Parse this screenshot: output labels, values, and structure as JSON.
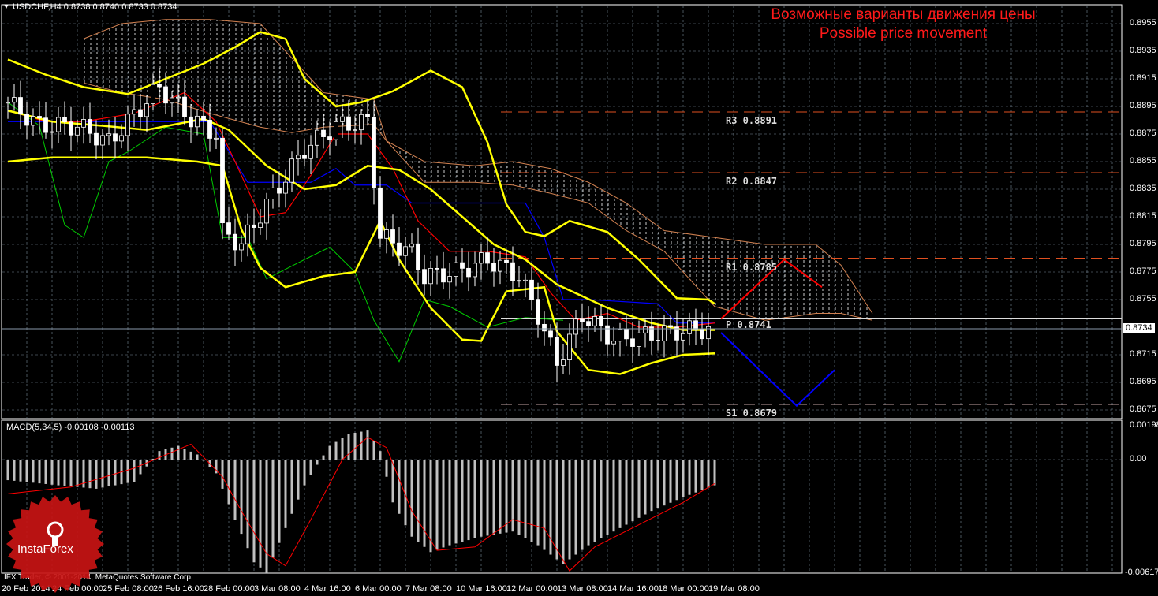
{
  "header": {
    "symbol_line": "USDCHF,H4  0.8738 0.8740 0.8733 0.8734"
  },
  "title": {
    "ru": "Возможные варианты движения цены",
    "en": "Possible price movement"
  },
  "macd_label": "MACD(5,34,5) -0.00108 -0.00113",
  "copyright": "IFX Trader, © 2001-2014, MetaQuotes Software Corp.",
  "logo": "InstaForex",
  "current_price": "0.8734",
  "price_axis": [
    "0.8955",
    "0.8935",
    "0.8915",
    "0.8895",
    "0.8875",
    "0.8855",
    "0.8835",
    "0.8815",
    "0.8795",
    "0.8775",
    "0.8755",
    "0.8715",
    "0.8695",
    "0.8675"
  ],
  "macd_axis": [
    "0.00198",
    "0.00",
    "-0.00617"
  ],
  "time_axis": [
    "20 Feb 2014",
    "24 Feb 00:00",
    "25 Feb 08:00",
    "26 Feb 16:00",
    "28 Feb 00:00",
    "3 Mar 08:00",
    "4 Mar 16:00",
    "6 Mar 00:00",
    "7 Mar 08:00",
    "10 Mar 16:00",
    "12 Mar 00:00",
    "13 Mar 08:00",
    "14 Mar 16:00",
    "18 Mar 00:00",
    "19 Mar 08:00"
  ],
  "pivots": [
    {
      "name": "R3",
      "value": 0.8891,
      "label": "R3  0.8891"
    },
    {
      "name": "R2",
      "value": 0.8847,
      "label": "R2  0.8847"
    },
    {
      "name": "R1",
      "value": 0.8785,
      "label": "R1  0.8785"
    },
    {
      "name": "P",
      "value": 0.8741,
      "label": "P  0.8741"
    },
    {
      "name": "S1",
      "value": 0.8679,
      "label": "S1  0.8679"
    }
  ],
  "colors": {
    "bg": "#000000",
    "grid": "#7a8a99",
    "bollinger": "#ffff00",
    "tenkan": "#ff0000",
    "kijun": "#0000ff",
    "chikou": "#00cc00",
    "up_scenario": "#ff0000",
    "down_scenario": "#0000ff",
    "cloud": "#ffffff",
    "macd_hist": "#c0c0c0",
    "macd_signal": "#ff0000"
  },
  "chart_data": {
    "type": "candlestick",
    "price_range": [
      0.8662,
      0.8968
    ],
    "close_keys": [
      [
        0,
        0.8898
      ],
      [
        5,
        0.8881
      ],
      [
        11,
        0.8881
      ],
      [
        16,
        0.8869
      ],
      [
        24,
        0.8909
      ],
      [
        29,
        0.8886
      ],
      [
        33,
        0.8875
      ],
      [
        34,
        0.8804
      ],
      [
        37,
        0.8795
      ],
      [
        41,
        0.8824
      ],
      [
        47,
        0.8864
      ],
      [
        52,
        0.8881
      ],
      [
        57,
        0.8884
      ],
      [
        59,
        0.8801
      ],
      [
        64,
        0.8789
      ],
      [
        66,
        0.8772
      ],
      [
        71,
        0.8775
      ],
      [
        76,
        0.8784
      ],
      [
        81,
        0.8772
      ],
      [
        84,
        0.8744
      ],
      [
        87,
        0.8709
      ],
      [
        91,
        0.8744
      ],
      [
        96,
        0.8726
      ],
      [
        101,
        0.8729
      ],
      [
        106,
        0.8732
      ],
      [
        111,
        0.8734
      ]
    ],
    "bollinger_upper": [
      [
        0,
        0.8929
      ],
      [
        6,
        0.8918
      ],
      [
        12,
        0.8909
      ],
      [
        19,
        0.8904
      ],
      [
        25,
        0.8915
      ],
      [
        31,
        0.8926
      ],
      [
        36,
        0.8938
      ],
      [
        40,
        0.8949
      ],
      [
        44,
        0.8944
      ],
      [
        47,
        0.8915
      ],
      [
        52,
        0.8895
      ],
      [
        56,
        0.8898
      ],
      [
        61,
        0.8906
      ],
      [
        67,
        0.8921
      ],
      [
        72,
        0.8909
      ],
      [
        76,
        0.8869
      ],
      [
        79,
        0.8824
      ],
      [
        82,
        0.8804
      ],
      [
        85,
        0.8801
      ],
      [
        89,
        0.8812
      ],
      [
        95,
        0.8804
      ],
      [
        100,
        0.8784
      ],
      [
        106,
        0.8756
      ],
      [
        111,
        0.8755
      ],
      [
        112,
        0.8752
      ]
    ],
    "bollinger_mid": [
      [
        0,
        0.8892
      ],
      [
        7,
        0.8884
      ],
      [
        15,
        0.8881
      ],
      [
        22,
        0.8878
      ],
      [
        31,
        0.8886
      ],
      [
        35,
        0.8878
      ],
      [
        41,
        0.8852
      ],
      [
        47,
        0.8835
      ],
      [
        52,
        0.8838
      ],
      [
        57,
        0.8852
      ],
      [
        62,
        0.8849
      ],
      [
        67,
        0.8835
      ],
      [
        72,
        0.8815
      ],
      [
        77,
        0.8795
      ],
      [
        82,
        0.8784
      ],
      [
        87,
        0.8766
      ],
      [
        95,
        0.8749
      ],
      [
        102,
        0.8738
      ],
      [
        107,
        0.8733
      ],
      [
        112,
        0.8733
      ]
    ],
    "bollinger_lower": [
      [
        0,
        0.8855
      ],
      [
        7,
        0.8858
      ],
      [
        15,
        0.8858
      ],
      [
        22,
        0.8858
      ],
      [
        30,
        0.8855
      ],
      [
        34,
        0.8852
      ],
      [
        37,
        0.8806
      ],
      [
        40,
        0.8778
      ],
      [
        44,
        0.8764
      ],
      [
        50,
        0.8772
      ],
      [
        55,
        0.8775
      ],
      [
        59,
        0.8812
      ],
      [
        62,
        0.8784
      ],
      [
        67,
        0.8749
      ],
      [
        72,
        0.8726
      ],
      [
        75,
        0.8725
      ],
      [
        79,
        0.8761
      ],
      [
        85,
        0.8764
      ],
      [
        87,
        0.8732
      ],
      [
        92,
        0.8704
      ],
      [
        97,
        0.8701
      ],
      [
        102,
        0.8709
      ],
      [
        107,
        0.8715
      ],
      [
        112,
        0.8716
      ]
    ],
    "tenkan": [
      [
        0,
        0.8892
      ],
      [
        6,
        0.8884
      ],
      [
        12,
        0.8884
      ],
      [
        20,
        0.889
      ],
      [
        28,
        0.8905
      ],
      [
        33,
        0.8884
      ],
      [
        36,
        0.8855
      ],
      [
        40,
        0.8815
      ],
      [
        44,
        0.8818
      ],
      [
        48,
        0.8845
      ],
      [
        52,
        0.8875
      ],
      [
        57,
        0.8875
      ],
      [
        61,
        0.885
      ],
      [
        65,
        0.8812
      ],
      [
        70,
        0.879
      ],
      [
        76,
        0.879
      ],
      [
        82,
        0.8786
      ],
      [
        86,
        0.876
      ],
      [
        90,
        0.874
      ],
      [
        95,
        0.8745
      ],
      [
        100,
        0.8735
      ],
      [
        106,
        0.8735
      ],
      [
        112,
        0.8738
      ]
    ],
    "kijun": [
      [
        0,
        0.8884
      ],
      [
        20,
        0.8884
      ],
      [
        32,
        0.8884
      ],
      [
        34,
        0.887
      ],
      [
        38,
        0.884
      ],
      [
        48,
        0.884
      ],
      [
        52,
        0.885
      ],
      [
        55,
        0.8838
      ],
      [
        60,
        0.8838
      ],
      [
        64,
        0.8825
      ],
      [
        82,
        0.8825
      ],
      [
        85,
        0.88
      ],
      [
        88,
        0.8755
      ],
      [
        92,
        0.8755
      ],
      [
        103,
        0.8752
      ],
      [
        106,
        0.8738
      ],
      [
        112,
        0.8738
      ]
    ],
    "chikou": [
      [
        0,
        0.8898
      ],
      [
        5,
        0.8881
      ],
      [
        9,
        0.8809
      ],
      [
        12,
        0.88
      ],
      [
        16,
        0.8855
      ],
      [
        19,
        0.8862
      ],
      [
        25,
        0.888
      ],
      [
        31,
        0.8875
      ],
      [
        34,
        0.88
      ],
      [
        38,
        0.88
      ],
      [
        41,
        0.877
      ],
      [
        47,
        0.8784
      ],
      [
        51,
        0.8793
      ],
      [
        55,
        0.8775
      ],
      [
        58,
        0.874
      ],
      [
        62,
        0.871
      ],
      [
        66,
        0.8755
      ],
      [
        70,
        0.875
      ],
      [
        76,
        0.8735
      ],
      [
        82,
        0.8742
      ],
      [
        88,
        0.874
      ]
    ],
    "cloud": [
      [
        12,
        0.8944,
        0.8912
      ],
      [
        18,
        0.8955,
        0.8905
      ],
      [
        25,
        0.8958,
        0.89
      ],
      [
        32,
        0.8958,
        0.889
      ],
      [
        40,
        0.8955,
        0.888
      ],
      [
        45,
        0.893,
        0.8876
      ],
      [
        50,
        0.8905,
        0.888
      ],
      [
        58,
        0.89,
        0.8882
      ],
      [
        60,
        0.887,
        0.887
      ],
      [
        66,
        0.8855,
        0.884
      ],
      [
        74,
        0.8852,
        0.884
      ],
      [
        80,
        0.8855,
        0.8838
      ],
      [
        86,
        0.885,
        0.8832
      ],
      [
        92,
        0.884,
        0.8825
      ],
      [
        98,
        0.8825,
        0.8805
      ],
      [
        104,
        0.8805,
        0.879
      ],
      [
        112,
        0.88,
        0.875
      ],
      [
        120,
        0.8795,
        0.874
      ],
      [
        128,
        0.8795,
        0.8745
      ],
      [
        132,
        0.878,
        0.8745
      ],
      [
        137,
        0.8745,
        0.874
      ]
    ],
    "scenario_up": [
      [
        113,
        0.8741
      ],
      [
        123,
        0.8784
      ],
      [
        129,
        0.8764
      ]
    ],
    "scenario_down": [
      [
        113,
        0.8731
      ],
      [
        125,
        0.8678
      ],
      [
        131,
        0.8704
      ]
    ],
    "macd_range": [
      -0.0066,
      0.0022
    ],
    "macd_hist_keys": [
      [
        0,
        -0.0012
      ],
      [
        8,
        -0.0015
      ],
      [
        14,
        -0.0017
      ],
      [
        20,
        -0.0013
      ],
      [
        24,
        0.0005
      ],
      [
        27,
        0.0008
      ],
      [
        30,
        0.0003
      ],
      [
        33,
        -0.0008
      ],
      [
        36,
        -0.0035
      ],
      [
        39,
        -0.006
      ],
      [
        41,
        -0.0066
      ],
      [
        44,
        -0.004
      ],
      [
        47,
        -0.0015
      ],
      [
        49,
        -0.0003
      ],
      [
        51,
        0.0008
      ],
      [
        54,
        0.0015
      ],
      [
        57,
        0.0017
      ],
      [
        59,
        0.0005
      ],
      [
        61,
        -0.0025
      ],
      [
        64,
        -0.0045
      ],
      [
        67,
        -0.0054
      ],
      [
        70,
        -0.005
      ],
      [
        75,
        -0.0045
      ],
      [
        80,
        -0.0042
      ],
      [
        84,
        -0.005
      ],
      [
        88,
        -0.0061
      ],
      [
        92,
        -0.005
      ],
      [
        97,
        -0.004
      ],
      [
        102,
        -0.003
      ],
      [
        107,
        -0.0022
      ],
      [
        112,
        -0.0015
      ]
    ],
    "macd_signal_keys": [
      [
        0,
        -0.002
      ],
      [
        10,
        -0.0016
      ],
      [
        20,
        -0.0005
      ],
      [
        29,
        0.0009
      ],
      [
        34,
        -0.001
      ],
      [
        37,
        -0.003
      ],
      [
        41,
        -0.0055
      ],
      [
        44,
        -0.0062
      ],
      [
        48,
        -0.0035
      ],
      [
        53,
        0.0
      ],
      [
        57,
        0.0013
      ],
      [
        60,
        0.0007
      ],
      [
        64,
        -0.003
      ],
      [
        68,
        -0.0053
      ],
      [
        74,
        -0.0051
      ],
      [
        80,
        -0.0035
      ],
      [
        85,
        -0.004
      ],
      [
        89,
        -0.0065
      ],
      [
        93,
        -0.0051
      ],
      [
        100,
        -0.0038
      ],
      [
        107,
        -0.0025
      ],
      [
        112,
        -0.0014
      ]
    ]
  }
}
